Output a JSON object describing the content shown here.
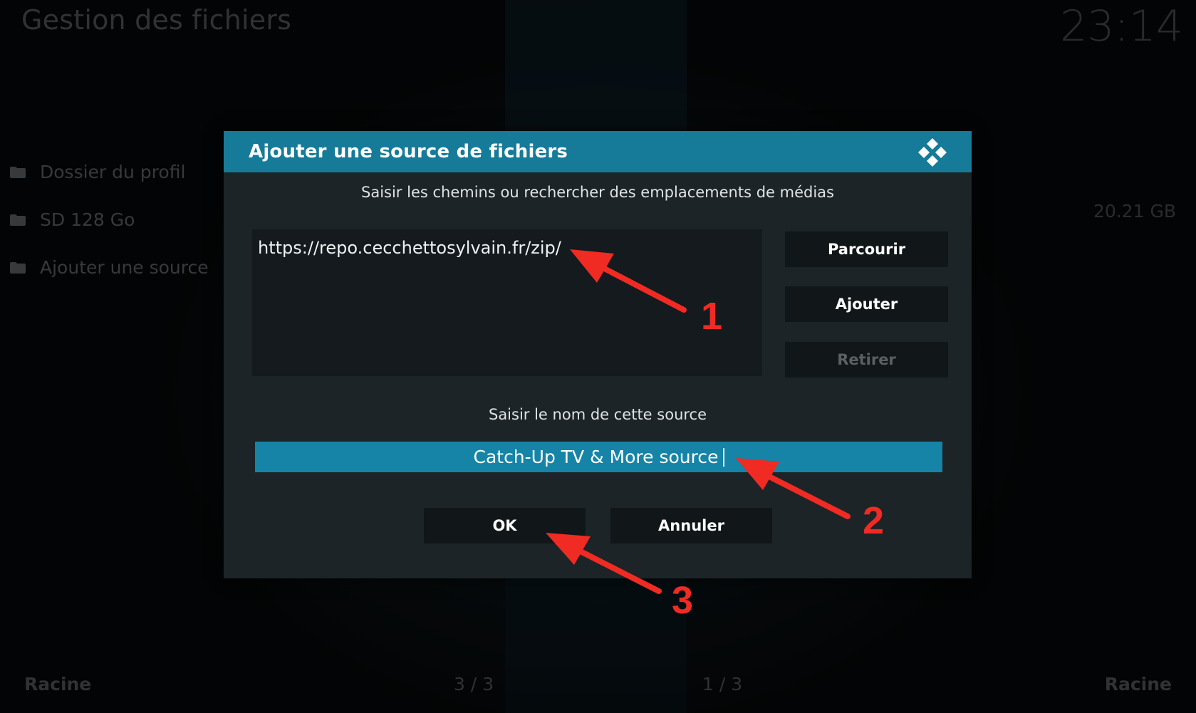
{
  "app": {
    "title": "Gestion des fichiers",
    "clock": "23:14"
  },
  "sidebar": {
    "items": [
      {
        "label": "Dossier du profil",
        "icon": "folder-icon"
      },
      {
        "label": "SD 128 Go",
        "icon": "folder-icon"
      },
      {
        "label": "Ajouter une source",
        "icon": "folder-icon"
      }
    ],
    "right_value": "20.21 GB"
  },
  "footer": {
    "left_label": "Racine",
    "left_page": "3 / 3",
    "right_page": "1 / 3",
    "right_label": "Racine"
  },
  "dialog": {
    "title": "Ajouter une source de fichiers",
    "logo": "kodi-logo-icon",
    "paths_caption": "Saisir les chemins ou rechercher des emplacements de médias",
    "path_value": "https://repo.cecchettosylvain.fr/zip/",
    "buttons": {
      "browse": "Parcourir",
      "add": "Ajouter",
      "remove": "Retirer"
    },
    "name_caption": "Saisir le nom de cette source",
    "name_value": "Catch-Up TV & More source",
    "ok": "OK",
    "cancel": "Annuler"
  },
  "annotations": [
    "1",
    "2",
    "3"
  ],
  "colors": {
    "header": "#167a99",
    "focused_input": "#1684a6",
    "annotation": "#ef2b24"
  }
}
